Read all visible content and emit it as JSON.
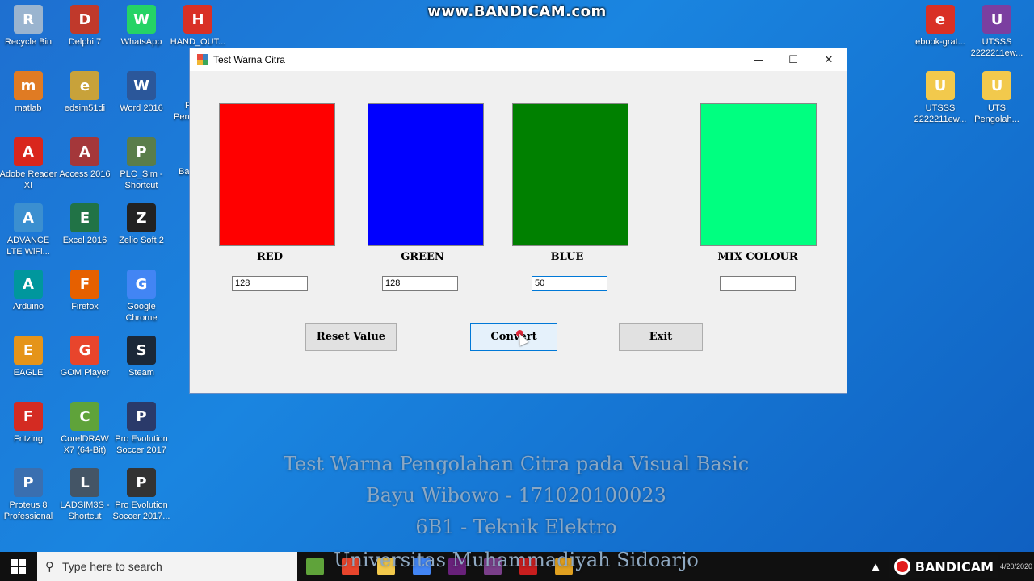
{
  "watermark": "www.BANDICAM.com",
  "desktop": {
    "left_icons": [
      {
        "label": "Recycle Bin",
        "icon": "recycle-bin-icon",
        "color": "#9ab4cf"
      },
      {
        "label": "Delphi 7",
        "icon": "delphi-icon",
        "color": "#c0392b"
      },
      {
        "label": "WhatsApp",
        "icon": "whatsapp-icon",
        "color": "#25d366"
      },
      {
        "label": "HAND_OUT...",
        "icon": "pdf-icon",
        "color": "#d93025"
      },
      {
        "label": "matlab",
        "icon": "matlab-icon",
        "color": "#e07b23"
      },
      {
        "label": "edsim51di",
        "icon": "folder-zip-icon",
        "color": "#c8a23a"
      },
      {
        "label": "Word 2016",
        "icon": "word-icon",
        "color": "#2b579a"
      },
      {
        "label": "Adobe Reader XI",
        "icon": "adobe-reader-icon",
        "color": "#d9261c"
      },
      {
        "label": "Access 2016",
        "icon": "access-icon",
        "color": "#a4373a"
      },
      {
        "label": "PLC_Sim - Shortcut",
        "icon": "plc-sim-icon",
        "color": "#5a7d4a"
      },
      {
        "label": "ADVANCE LTE WiFi...",
        "icon": "advance-lte-icon",
        "color": "#3b8fd0"
      },
      {
        "label": "Excel 2016",
        "icon": "excel-icon",
        "color": "#217346"
      },
      {
        "label": "Zelio Soft 2",
        "icon": "zelio-soft-icon",
        "color": "#222222"
      },
      {
        "label": "Arduino",
        "icon": "arduino-icon",
        "color": "#00979d"
      },
      {
        "label": "Firefox",
        "icon": "firefox-icon",
        "color": "#e66000"
      },
      {
        "label": "Google Chrome",
        "icon": "chrome-icon",
        "color": "#4285f4"
      },
      {
        "label": "EAGLE",
        "icon": "eagle-icon",
        "color": "#e5941a"
      },
      {
        "label": "GOM Player",
        "icon": "gom-player-icon",
        "color": "#e8452c"
      },
      {
        "label": "Steam",
        "icon": "steam-icon",
        "color": "#1b2838"
      },
      {
        "label": "Fritzing",
        "icon": "fritzing-icon",
        "color": "#d42b22"
      },
      {
        "label": "CorelDRAW X7 (64-Bit)",
        "icon": "coreldraw-icon",
        "color": "#5fa33a"
      },
      {
        "label": "Pro Evolution Soccer 2017",
        "icon": "pes-icon",
        "color": "#2a3a6a"
      },
      {
        "label": "Proteus 8 Professional",
        "icon": "proteus-icon",
        "color": "#3a6fb0"
      },
      {
        "label": "LADSIM3S - Shortcut",
        "icon": "ladsim-icon",
        "color": "#445566"
      },
      {
        "label": "Pro Evolution Soccer 2017...",
        "icon": "pes-icon",
        "color": "#333333"
      }
    ],
    "partial_labels": [
      "P",
      "Pen",
      "Ba"
    ],
    "right_icons": [
      {
        "label": "ebook-grat...",
        "icon": "pdf-icon",
        "color": "#d93025"
      },
      {
        "label": "UTSSS 2222211ew...",
        "icon": "winrar-icon",
        "color": "#7b3fa0"
      },
      {
        "label": "UTSSS 2222211ew...",
        "icon": "folder-icon",
        "color": "#f2c94c"
      },
      {
        "label": "UTS Pengolah...",
        "icon": "folder-icon",
        "color": "#f2c94c"
      }
    ]
  },
  "window": {
    "title": "Test Warna Citra",
    "minimize": "—",
    "maximize": "☐",
    "close": "✕",
    "swatches": [
      {
        "label": "RED",
        "color": "#ff0000",
        "value": "128"
      },
      {
        "label": "GREEN",
        "color": "#0000ff",
        "value": "128"
      },
      {
        "label": "BLUE",
        "color": "#008000",
        "value": "50"
      },
      {
        "label": "MIX COLOUR",
        "color": "#00ff80",
        "value": ""
      }
    ],
    "buttons": {
      "reset": "Reset Value",
      "convert": "Convert",
      "exit": "Exit"
    }
  },
  "caption": {
    "line1": "Test Warna Pengolahan Citra pada Visual Basic",
    "line2": "Bayu Wibowo - 171020100023",
    "line3": "6B1 - Teknik Elektro",
    "line4": "Universitas Muhammadiyah Sidoarjo"
  },
  "taskbar": {
    "search_placeholder": "Type here to search",
    "apps": [
      {
        "icon": "coreldraw-taskbar-icon",
        "color": "#5fa33a"
      },
      {
        "icon": "gom-taskbar-icon",
        "color": "#e8452c"
      },
      {
        "icon": "file-explorer-icon",
        "color": "#f2c94c"
      },
      {
        "icon": "chrome-taskbar-icon",
        "color": "#4285f4"
      },
      {
        "icon": "visual-studio-icon",
        "color": "#68217a"
      },
      {
        "icon": "media-icon",
        "color": "#7a3f8a"
      },
      {
        "icon": "bandicam-taskbar-icon",
        "color": "#c81e1e"
      },
      {
        "icon": "vb-app-icon",
        "color": "#e0a020"
      }
    ],
    "bandicam_logo": "BANDICAM",
    "clock_date": "4/20/2020"
  }
}
